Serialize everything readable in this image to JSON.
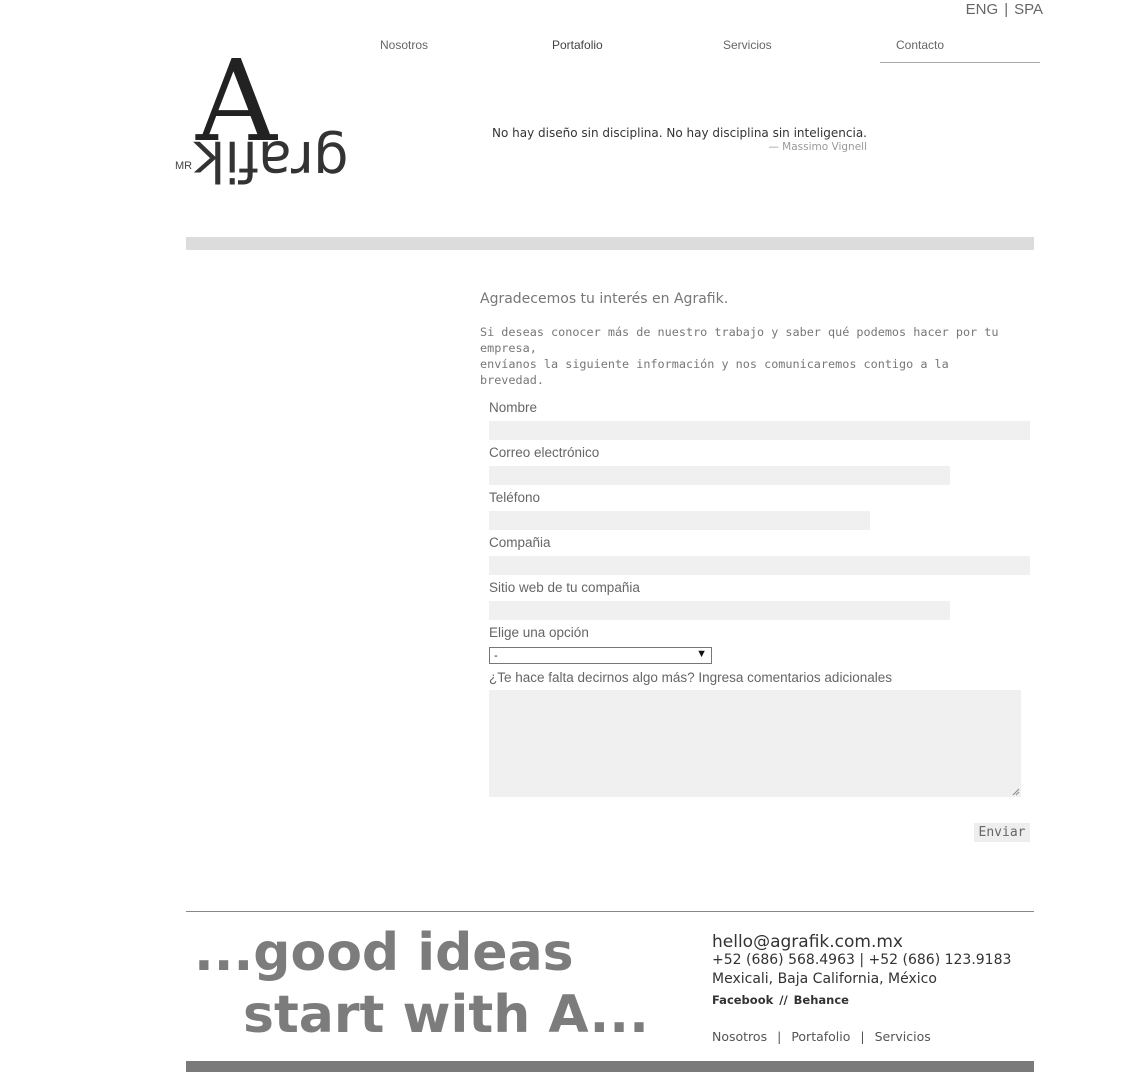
{
  "lang": {
    "eng": "ENG",
    "separator": "|",
    "spa": "SPA"
  },
  "nav": {
    "nosotros": "Nosotros",
    "portafolio": "Portafolio",
    "servicios": "Servicios",
    "contacto": "Contacto"
  },
  "logo": {
    "letter": "A",
    "word": "grafik",
    "prefix": "MR"
  },
  "quote": {
    "text": "No hay diseño sin disciplina. No hay disciplina sin inteligencia.",
    "author": "— Massimo Vignell"
  },
  "intro": {
    "title": "Agradecemos tu interés en Agrafik.",
    "text_line1": "Si deseas conocer más de nuestro trabajo y saber qué podemos hacer por tu empresa,",
    "text_line2": "envíanos la siguiente información y nos comunicaremos contigo a la brevedad."
  },
  "form": {
    "name_label": "Nombre",
    "email_label": "Correo electrónico",
    "phone_label": "Teléfono",
    "company_label": "Compañia",
    "website_label": "Sitio web de tu compañia",
    "option_label": "Elige una opción",
    "option_selected": "-",
    "comments_label": "¿Te hace falta decirnos algo más? Ingresa comentarios adicionales",
    "submit_label": "Enviar",
    "name_value": "",
    "email_value": "",
    "phone_value": "",
    "company_value": "",
    "website_value": "",
    "comments_value": ""
  },
  "footer": {
    "slogan_line1": "...good ideas",
    "slogan_line2": "start with A...",
    "email": "hello@agrafik.com.mx",
    "phone": "+52 (686) 568.4963 | +52 (686) 123.9183",
    "city": "Mexicali, Baja California, México",
    "facebook": "Facebook",
    "social_separator": "//",
    "behance": "Behance",
    "nav_nosotros": "Nosotros",
    "nav_portafolio": "Portafolio",
    "nav_servicios": "Servicios",
    "nav_separator": "|"
  },
  "colors": {
    "field_bg": "#f0f0f0",
    "bar_light": "#dcdcdc",
    "bar_dark": "#7a7a7a",
    "slogan": "#7c7c7c"
  },
  "icons": {
    "select_arrow": "chevron-down-icon",
    "textarea_resize": "resize-handle-icon"
  }
}
